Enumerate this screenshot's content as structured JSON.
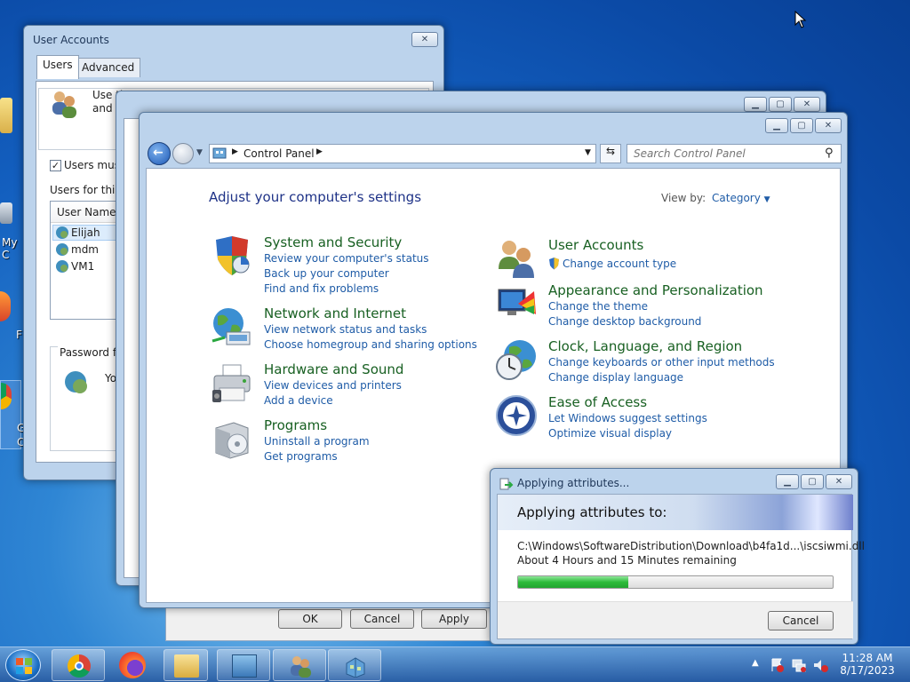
{
  "desktop": {
    "icons": [
      {
        "label": "My C",
        "icon": "computer-icon"
      },
      {
        "label": "F",
        "icon": "firefox-shortcut-icon"
      },
      {
        "label": "G",
        "icon": "chrome-shortcut-icon"
      },
      {
        "label": "C",
        "icon": "shortcut-icon"
      }
    ]
  },
  "user_accounts": {
    "title": "User Accounts",
    "tabs": [
      "Users",
      "Advanced"
    ],
    "intro_line1": "Use th",
    "intro_line2": "and t",
    "checkbox_label": "Users must",
    "users_for_label": "Users for this c",
    "column_header": "User Name",
    "users": [
      "Elijah",
      "mdm",
      "VM1"
    ],
    "password_label": "Password for",
    "password_text": "Yo",
    "buttons": {
      "ok": "OK",
      "cancel": "Cancel",
      "apply": "Apply"
    }
  },
  "control_panel": {
    "address_path": "Control Panel",
    "search_placeholder": "Search Control Panel",
    "heading": "Adjust your computer's settings",
    "view_by_label": "View by:",
    "view_by_value": "Category",
    "left_categories": [
      {
        "title": "System and Security",
        "links": [
          "Review your computer's status",
          "Back up your computer",
          "Find and fix problems"
        ]
      },
      {
        "title": "Network and Internet",
        "links": [
          "View network status and tasks",
          "Choose homegroup and sharing options"
        ]
      },
      {
        "title": "Hardware and Sound",
        "links": [
          "View devices and printers",
          "Add a device"
        ]
      },
      {
        "title": "Programs",
        "links": [
          "Uninstall a program",
          "Get programs"
        ]
      }
    ],
    "right_categories": [
      {
        "title": "User Accounts",
        "links": [
          "Change account type"
        ]
      },
      {
        "title": "Appearance and Personalization",
        "links": [
          "Change the theme",
          "Change desktop background"
        ]
      },
      {
        "title": "Clock, Language, and Region",
        "links": [
          "Change keyboards or other input methods",
          "Change display language"
        ]
      },
      {
        "title": "Ease of Access",
        "links": [
          "Let Windows suggest settings",
          "Optimize visual display"
        ]
      }
    ]
  },
  "applying_dialog": {
    "title": "Applying attributes...",
    "banner": "Applying attributes to:",
    "file_path": "C:\\Windows\\SoftwareDistribution\\Download\\b4fa1d...\\iscsiwmi.dll",
    "time_remaining": "About 4 Hours and 15 Minutes remaining",
    "progress": 0.35,
    "cancel_label": "Cancel"
  },
  "taskbar": {
    "apps": [
      "start-orb-icon",
      "chrome-icon",
      "firefox-icon",
      "file-explorer-icon",
      "control-panel-icon",
      "user-accounts-icon",
      "installer-icon"
    ],
    "time": "11:28 AM",
    "date": "8/17/2023"
  },
  "colors": {
    "link": "#1f5ca7",
    "category_title": "#186022",
    "heading": "#1e3287",
    "progress": "#2dbb3a"
  }
}
